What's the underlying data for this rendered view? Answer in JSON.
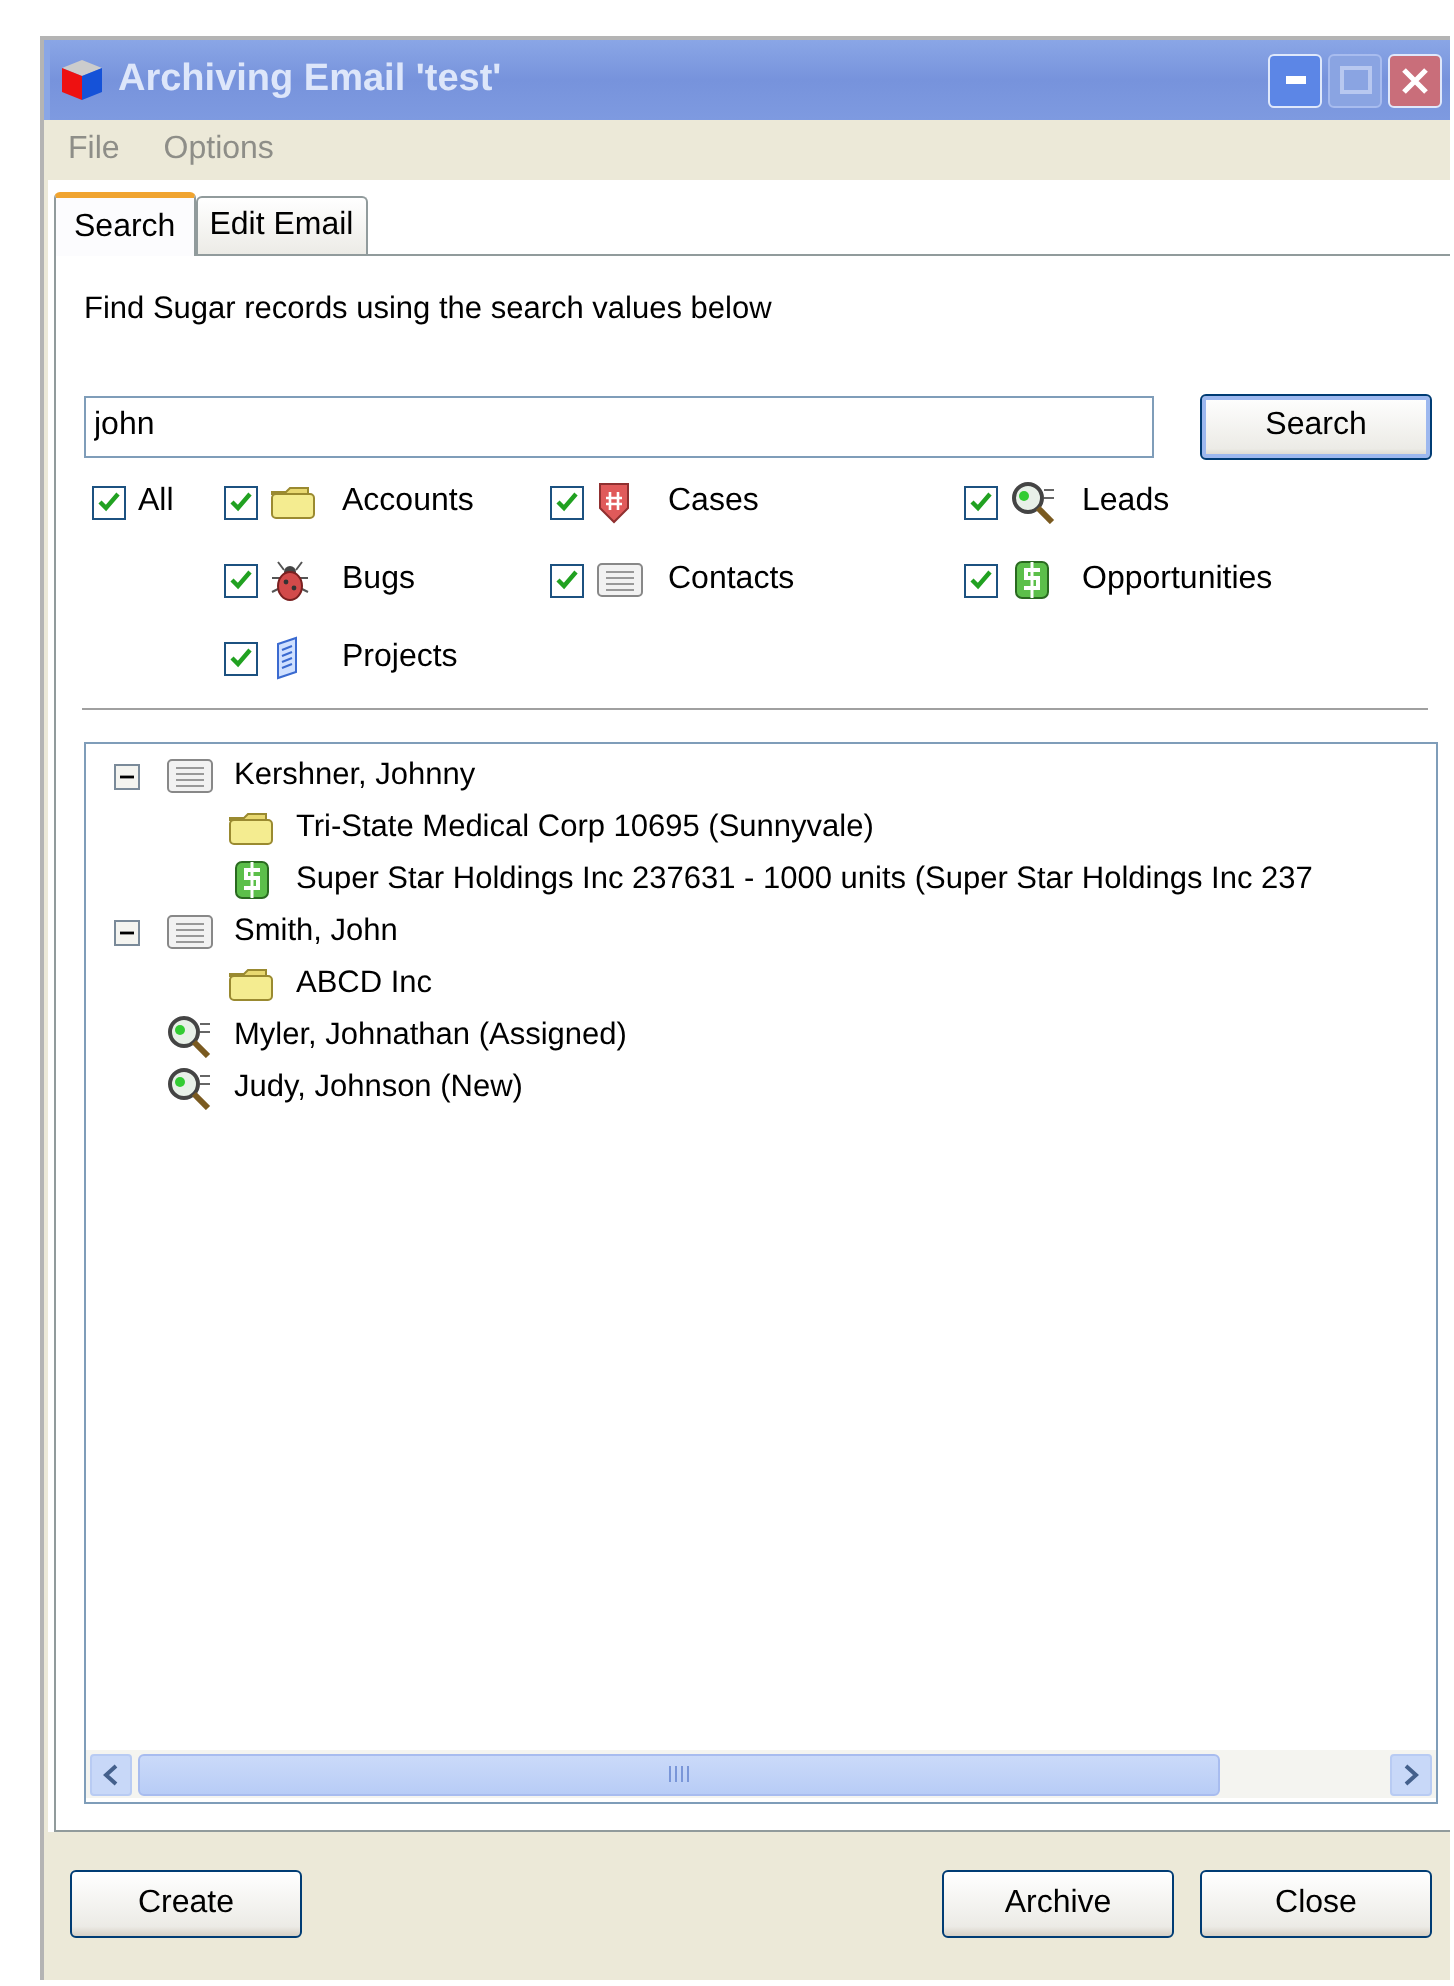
{
  "window": {
    "title": "Archiving Email 'test'"
  },
  "menu": [
    "File",
    "Options"
  ],
  "tabs": [
    {
      "label": "Search",
      "selected": true
    },
    {
      "label": "Edit Email",
      "selected": false
    }
  ],
  "instructions": "Find Sugar records using the search values below",
  "search": {
    "value": "john",
    "button": "Search"
  },
  "filters": [
    {
      "label": "All",
      "kind": "all",
      "checked": true
    },
    {
      "label": "Accounts",
      "kind": "account",
      "checked": true
    },
    {
      "label": "Cases",
      "kind": "case",
      "checked": true
    },
    {
      "label": "Leads",
      "kind": "lead",
      "checked": true
    },
    {
      "label": "Bugs",
      "kind": "bug",
      "checked": true
    },
    {
      "label": "Contacts",
      "kind": "contact",
      "checked": true
    },
    {
      "label": "Opportunities",
      "kind": "opportunity",
      "checked": true
    },
    {
      "label": "Projects",
      "kind": "project",
      "checked": true
    }
  ],
  "results": [
    {
      "label": "Kershner, Johnny",
      "kind": "contact",
      "expanded": true,
      "children": [
        {
          "label": "Tri-State Medical Corp 10695 (Sunnyvale)",
          "kind": "account"
        },
        {
          "label": "Super Star Holdings Inc 237631 - 1000 units (Super Star Holdings Inc 237",
          "kind": "opportunity"
        }
      ]
    },
    {
      "label": "Smith, John",
      "kind": "contact",
      "expanded": true,
      "children": [
        {
          "label": "ABCD Inc",
          "kind": "account"
        }
      ]
    },
    {
      "label": "Myler, Johnathan (Assigned)",
      "kind": "lead"
    },
    {
      "label": "Judy, Johnson (New)",
      "kind": "lead"
    }
  ],
  "buttons": [
    "Create",
    "Archive",
    "Close"
  ]
}
